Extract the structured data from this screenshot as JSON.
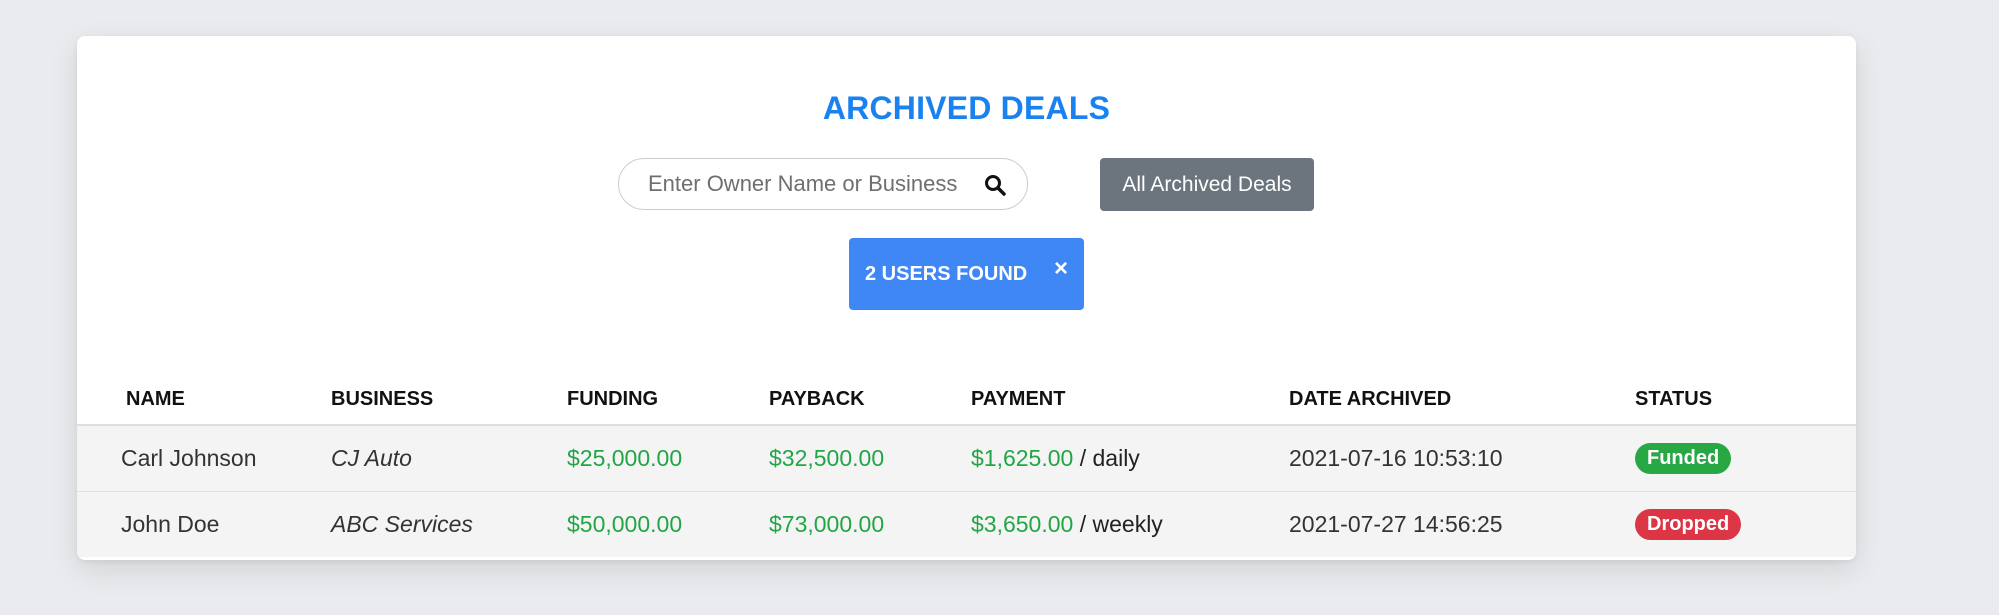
{
  "page": {
    "title": "ARCHIVED DEALS",
    "search": {
      "placeholder": "Enter Owner Name or Business",
      "value": ""
    },
    "all_archived_button": "All Archived Deals",
    "results_badge": {
      "label": "2 USERS FOUND",
      "close_symbol": "×"
    }
  },
  "table": {
    "headers": [
      "NAME",
      "BUSINESS",
      "FUNDING",
      "PAYBACK",
      "PAYMENT",
      "DATE ARCHIVED",
      "STATUS"
    ],
    "rows": [
      {
        "name": "Carl Johnson",
        "business": "CJ Auto",
        "funding": "$25,000.00",
        "payback": "$32,500.00",
        "payment_amount": "$1,625.00",
        "payment_freq": "/ daily",
        "date_archived": "2021-07-16 10:53:10",
        "status": "Funded"
      },
      {
        "name": "John Doe",
        "business": "ABC Services",
        "funding": "$50,000.00",
        "payback": "$73,000.00",
        "payment_amount": "$3,650.00",
        "payment_freq": "/ weekly",
        "date_archived": "2021-07-27 14:56:25",
        "status": "Dropped"
      }
    ]
  },
  "colors": {
    "accent": "#1a82f0",
    "money": "#22a645",
    "funded": "#28a745",
    "dropped": "#dc3545",
    "badge": "#3f87f5",
    "button_secondary": "#6c757d"
  },
  "icons": {
    "search": "search-icon",
    "close": "close-icon"
  }
}
